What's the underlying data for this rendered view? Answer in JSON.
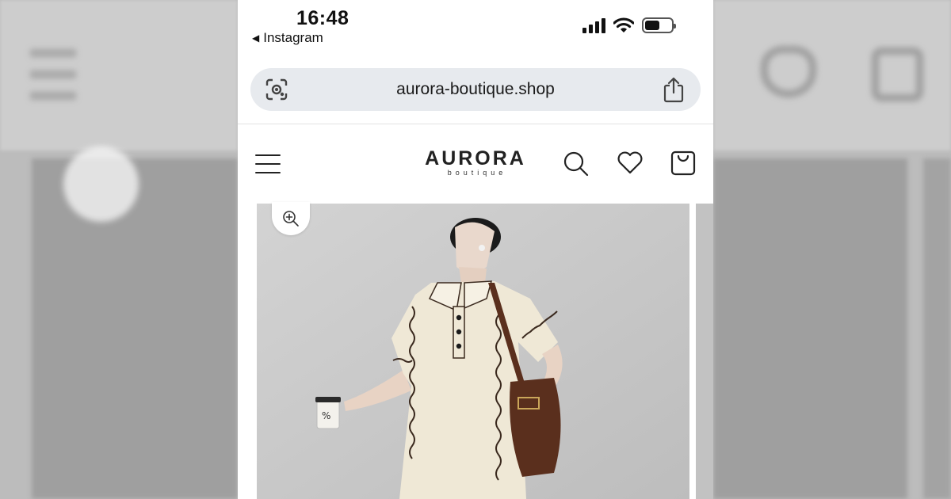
{
  "status_bar": {
    "time": "16:48",
    "back_app": "Instagram"
  },
  "browser": {
    "url": "aurora-boutique.shop"
  },
  "site": {
    "brand_name": "AURORA",
    "brand_sub": "boutique"
  },
  "product": {
    "cup_mark": "%"
  },
  "colors": {
    "url_bar": "#e7eaee",
    "backdrop": "#b9b9b9",
    "photo_bg": "#c9c9c9",
    "dress": "#efe8d6",
    "bag": "#5a2f1d"
  },
  "icons": [
    "lens-icon",
    "share-icon",
    "menu-icon",
    "search-icon",
    "heart-icon",
    "bag-icon",
    "zoom-in-icon",
    "wifi-icon",
    "signal-icon",
    "battery-icon"
  ]
}
